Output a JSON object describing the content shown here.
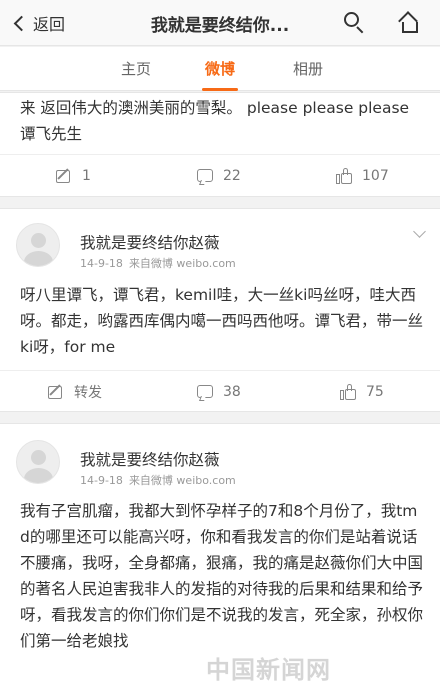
{
  "navbar": {
    "back_label": "返回",
    "title": "我就是要终结你...",
    "search_icon": "search-icon",
    "home_icon": "home-icon"
  },
  "tabs": [
    {
      "label": "主页",
      "active": false
    },
    {
      "label": "微博",
      "active": true
    },
    {
      "label": "相册",
      "active": false
    }
  ],
  "accent_color": "#f76a16",
  "posts": [
    {
      "text": "来 返回伟大的澳洲美丽的雪梨。 please please please 谭飞先生",
      "actions": {
        "repost": "1",
        "comment": "22",
        "like": "107"
      }
    },
    {
      "username": "我就是要终结你赵薇",
      "date": "14-9-18",
      "source": "来自微博 weibo.com",
      "text": "呀八里谭飞，谭飞君，kemil哇，大一丝ki吗丝呀，哇大西呀。都走，哟露西库偶内噶一西吗西他呀。谭飞君，带一丝ki呀，for me",
      "actions": {
        "repost": "转发",
        "comment": "38",
        "like": "75"
      }
    },
    {
      "username": "我就是要终结你赵薇",
      "date": "14-9-18",
      "source": "来自微博 weibo.com",
      "text": "我有子宫肌瘤，我都大到怀孕样子的7和8个月份了，我tmd的哪里还可以能高兴呀，你和看我发言的你们是站着说话不腰痛，我呀，全身都痛，狠痛，我的痛是赵薇你们大中国的著名人民迫害我非人的发指的对待我的后果和结果和给予呀，看我发言的你们你们是不说我的发言，死全家，孙权你们第一给老娘找"
    }
  ],
  "watermark": "中国新闻网"
}
